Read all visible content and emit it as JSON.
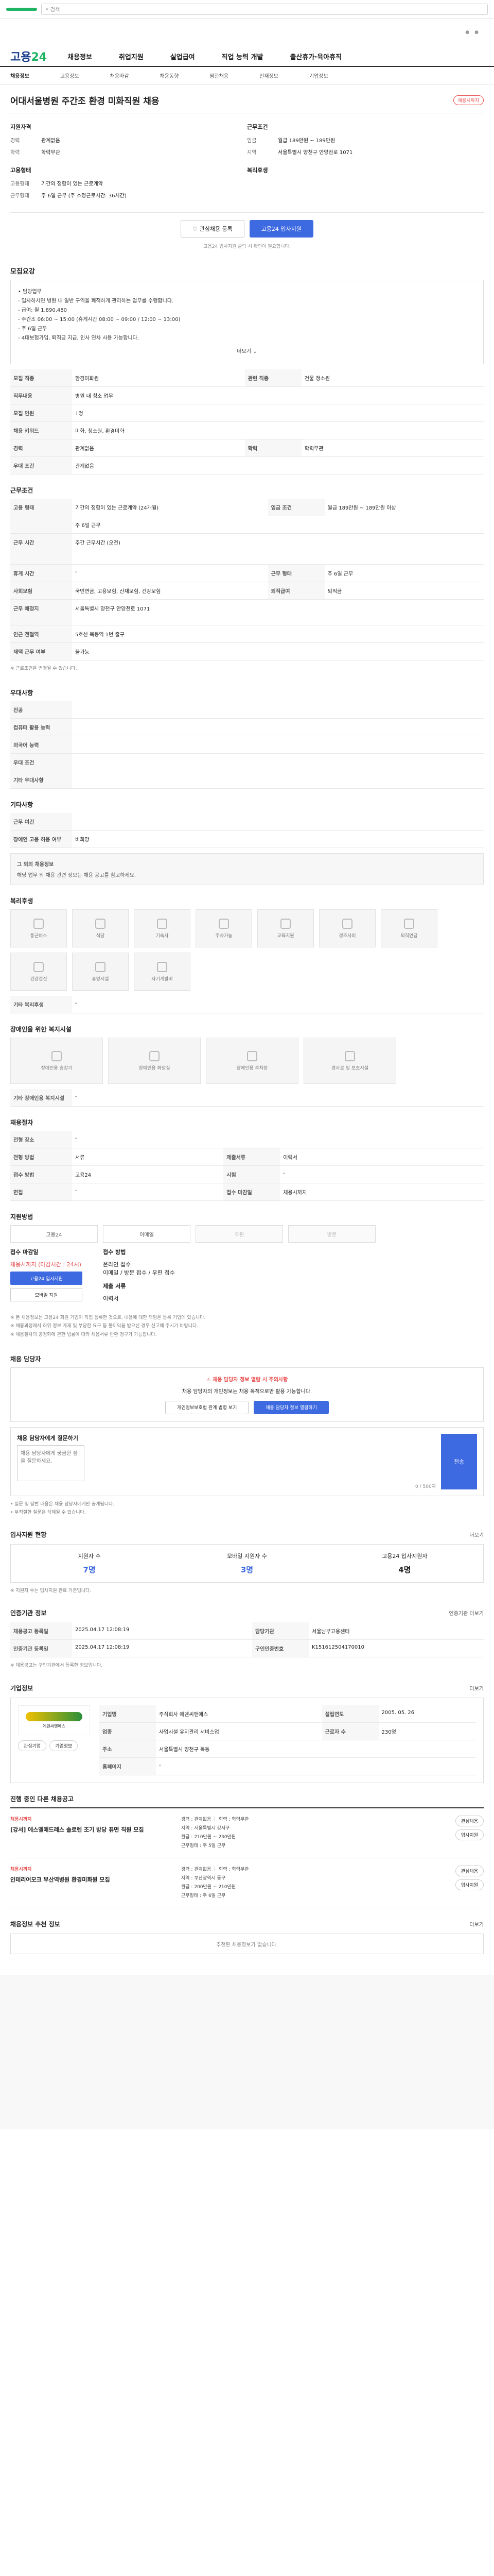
{
  "topbar": {
    "search_placeholder": "검색",
    "status_label": "진행"
  },
  "gnb": {
    "logo_a": "고용",
    "logo_b": "24",
    "menu": [
      "채용정보",
      "취업지원",
      "실업급여",
      "직업 능력 개발",
      "출산휴가·육아휴직"
    ]
  },
  "lnb": [
    "채용정보",
    "고용정보",
    "채용마감",
    "채용동향",
    "찜한채용",
    "인재정보",
    "기업정보"
  ],
  "job": {
    "title": "어대서울병원 주간조 환경 미화직원 채용",
    "badge": "채용시까지",
    "summary": {
      "company_head": "지원자격",
      "cond_head": "근무조건",
      "items_left": [
        {
          "k": "경력",
          "v": "관계없음"
        },
        {
          "k": "학력",
          "v": "학력무관"
        }
      ],
      "items_right": [
        {
          "k": "임금",
          "v": "월급 189만원 ~ 189만원"
        },
        {
          "k": "지역",
          "v": "서울특별시 양천구 안양천로 1071"
        }
      ],
      "form_head": "고용형태",
      "form_items": [
        {
          "k": "고용형태",
          "v": "기간의 정함이 있는 근로계약"
        },
        {
          "k": "근무형태",
          "v": "주 6일 근무 (주 소정근로시간: 36시간)"
        }
      ],
      "welfare_head": "복리후생"
    },
    "btn_save": "관심채용 등록",
    "btn_apply": "고용24 입사지원",
    "note": "고용24 입사지원 클릭 시 확인이 필요합니다."
  },
  "detail": {
    "h": "모집요강",
    "box_lines": [
      "• 담당업무",
      "- 입사하시면 병원 내 일반 구역을 쾌적하게 관리하는 업무를 수행합니다.",
      "- 급여: 월 1,890,480",
      "- 주간조 06:00 ~ 15:00 (휴게시간 08:00 ~ 09:00 / 12:00 ~ 13:00)",
      "- 주 6일 근무",
      "- 4대보험가입, 퇴직금 지급, 인사 연차 사용 가능합니다."
    ],
    "more_label": "더보기"
  },
  "table1": [
    {
      "k": "모집 직종",
      "v": "환경미화원",
      "k2": "관련 직종",
      "v2": "건물 청소원"
    },
    {
      "k": "직무내용",
      "v": "병원 내 청소 업무",
      "k2": "",
      "v2": ""
    },
    {
      "k": "모집 인원",
      "v": "1명",
      "k2": "",
      "v2": ""
    },
    {
      "k": "채용 키워드",
      "v": "미화, 청소원, 환경미화",
      "k2": "",
      "v2": ""
    },
    {
      "k": "경력",
      "v": "관계없음",
      "k2": "학력",
      "v2": "학력무관"
    },
    {
      "k": "우대 조건",
      "v": "관계없음",
      "k2": "",
      "v2": ""
    }
  ],
  "cond": {
    "h": "근무조건",
    "rows": [
      {
        "k": "고용 형태",
        "v": "기간의 정함이 있는 근로계약 (24개월)",
        "k2": "임금 조건",
        "v2": "월급 189만원 ~ 189만원 이상"
      },
      {
        "k": "",
        "v": "주 6일 근무",
        "k2": "",
        "v2": ""
      },
      {
        "k": "근무 시간",
        "v": "주간 근무시간 (오전)",
        "k2": "",
        "v2": ""
      },
      {
        "k": "휴게 시간",
        "v": "-",
        "k2": "근무 형태",
        "v2": "주 6일 근무"
      },
      {
        "k": "사회보험",
        "v": "국민연금, 고용보험, 산재보험, 건강보험",
        "k2": "퇴직급여",
        "v2": "퇴직금"
      },
      {
        "k": "근무 예정지",
        "v": "서울특별시 양천구 안양천로 1071",
        "k2": "",
        "v2": ""
      },
      {
        "k": "인근 전철역",
        "v": "5호선 목동역 1번 출구",
        "k2": "",
        "v2": ""
      },
      {
        "k": "재택 근무 여부",
        "v": "불가능",
        "k2": "",
        "v2": ""
      }
    ],
    "footnote": "※ 근로조건은 변경될 수 있습니다."
  },
  "pref": {
    "h": "우대사항",
    "rows": [
      {
        "k": "전공",
        "v": ""
      },
      {
        "k": "컴퓨터 활용 능력",
        "v": ""
      },
      {
        "k": "외국어 능력",
        "v": ""
      },
      {
        "k": "우대 조건",
        "v": ""
      },
      {
        "k": "기타 우대사항",
        "v": ""
      }
    ]
  },
  "etc": {
    "h": "기타사항",
    "rows": [
      {
        "k": "근무 여건",
        "v": ""
      },
      {
        "k": "장애인 고용 허용 여부",
        "v": "비희망"
      }
    ],
    "info_title": "그 외의 채용정보",
    "info_text": "해당 업무 외 채용 관련 정보는 채용 공고를 참고하세요."
  },
  "welfare": {
    "h": "복리후생",
    "items": [
      "통근버스",
      "식당",
      "기숙사",
      "주차가능",
      "교육지원",
      "경조사비",
      "퇴직연금",
      "건강검진",
      "휴양시설",
      "자기계발비"
    ],
    "sub_h": "기타 복리후생",
    "sub_v": "-"
  },
  "disability": {
    "h": "장애인을 위한 복지시설",
    "items": [
      "장애인용 승강기",
      "장애인용 화장실",
      "장애인용 주차장",
      "경사로 및 보조시설"
    ],
    "sub_h": "기타 장애인용 복지시설",
    "sub_v": "-"
  },
  "process": {
    "h": "채용절차",
    "rows": [
      {
        "k": "전형 장소",
        "v": "-"
      },
      {
        "k": "전형 방법",
        "v": "서류",
        "k2": "제출서류",
        "v2": "이력서"
      },
      {
        "k": "접수 방법",
        "v": "고용24",
        "k2": "시험",
        "v2": "-"
      },
      {
        "k": "면접",
        "v": "-",
        "k2": "접수 마감일",
        "v2": "채용시까지"
      }
    ]
  },
  "methods": {
    "h": "지원방법",
    "items": [
      "고용24",
      "이메일",
      "우편",
      "방문"
    ],
    "dims": [
      false,
      false,
      true,
      true
    ]
  },
  "apply": {
    "col1_h": "접수 마감일",
    "col1_v": "채용시까지 (마감시간 : 24시)",
    "col1_btn": "고용24 입사지원",
    "col1_btn2": "모바일 지원",
    "col2_h": "접수 방법",
    "col2_v1": "온라인 접수",
    "col2_v2": "이메일 / 방문 접수 / 우편 접수",
    "col2_h2": "제출 서류",
    "col2_v3": "이력서"
  },
  "notes": [
    "※ 본 채용정보는 고용24 회원 기업이 직접 등록한 것으로, 내용에 대한 책임은 등록 기업에 있습니다.",
    "※ 채용과정에서 허위 정보 게재 및 부당한 요구 등 불이익을 받으신 경우 신고해 주시기 바랍니다.",
    "※ 채용절차의 공정화에 관한 법률에 따라 채용서류 반환 청구가 가능합니다."
  ],
  "manager": {
    "h": "채용 담당자",
    "warn": "채용 담당자 정보 열람 시 주의사항",
    "warn_text": "채용 담당자의 개인정보는 채용 목적으로만 활용 가능합니다.",
    "btn1": "개인정보보호법 관계 법령 보기",
    "btn2": "채용 담당자 정보 열람하기",
    "qa_h": "채용 담당자에게 질문하기",
    "qa_placeholder": "채용 담당자에게 궁금한 점을 질문하세요.",
    "qa_count": "0 / 500자",
    "qa_send": "전송",
    "qa_notes": [
      "• 질문 및 답변 내용은 채용 담당자에게만 공개됩니다.",
      "• 부적절한 질문은 삭제될 수 있습니다."
    ]
  },
  "stats": {
    "h": "입사지원 현황",
    "more": "더보기",
    "items": [
      {
        "label": "지원자 수",
        "value": "7명",
        "blue": true
      },
      {
        "label": "모바일 지원자 수",
        "value": "3명",
        "blue": true
      },
      {
        "label": "고용24 입사지원자",
        "value": "4명",
        "blue": false
      }
    ],
    "note": "※ 지원자 수는 입사지원 완료 기준입니다."
  },
  "register": {
    "h": "인증기관 정보",
    "more": "인증기관 더보기",
    "rows": [
      {
        "k": "채용공고 등록일",
        "v": "2025.04.17 12:08:19",
        "k2": "담당기관",
        "v2": "서울남부고용센터"
      },
      {
        "k": "인증기관 등록일",
        "v": "2025.04.17 12:08:19",
        "k2": "구인인증번호",
        "v2": "K151612504170010"
      }
    ],
    "note": "※ 채용공고는 구인기관에서 등록한 정보입니다."
  },
  "company": {
    "h": "기업정보",
    "more": "더보기",
    "name": "에덴씨앤에스",
    "rows": [
      {
        "k": "기업명",
        "v": "주식회사 에덴씨앤에스",
        "k2": "설립연도",
        "v2": "2005. 05. 26"
      },
      {
        "k": "업종",
        "v": "사업시설 유지관리 서비스업",
        "k2": "근로자 수",
        "v2": "230명"
      },
      {
        "k": "주소",
        "v": "서울특별시 양천구 목동",
        "k2": "",
        "v2": ""
      },
      {
        "k": "홈페이지",
        "v": "-",
        "k2": "",
        "v2": ""
      }
    ],
    "btn_follow": "관심기업",
    "btn_detail": "기업정보"
  },
  "related": {
    "h": "진행 중인 다른 채용공고",
    "items": [
      {
        "tag": "채용시까지",
        "name": "[강서] 에스엘애드레스 솔로렌 조기 방당 퓨면 직원 모집",
        "lines": [
          "경력 : 관계없음 ｜ 학력 : 학력무관",
          "지역 : 서울특별시 강서구",
          "월급 : 210만원 ~ 230만원",
          "근무형태 : 주 5일 근무"
        ],
        "pills": [
          "관심채용",
          "입사지원"
        ]
      },
      {
        "tag": "채용시까지",
        "name": "인테리어모크 부산역병원 환경미화원 모집",
        "lines": [
          "경력 : 관계없음 ｜ 학력 : 학력무관",
          "지역 : 부산광역시 동구",
          "월급 : 200만원 ~ 210만원",
          "근무형태 : 주 6일 근무"
        ],
        "pills": [
          "관심채용",
          "입사지원"
        ]
      }
    ]
  },
  "recommend": {
    "h": "채용정보 추천 정보",
    "more": "더보기",
    "empty": "추천된 채용정보가 없습니다."
  }
}
